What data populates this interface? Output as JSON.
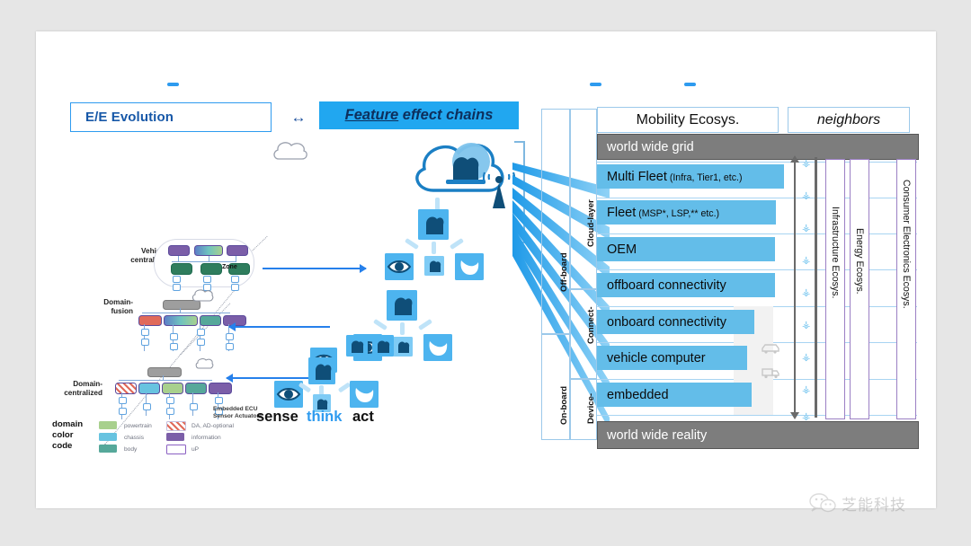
{
  "canvas": {
    "background": "#e6e6e6",
    "slide_background": "#ffffff"
  },
  "header": {
    "ee_evolution": "E/E Evolution",
    "bidirectional_arrow": "↔",
    "feature_effect_chains": {
      "underlined_word": "Feature",
      "rest": " effect chains",
      "full": "Feature effect chains"
    }
  },
  "left_diagram": {
    "levels": [
      {
        "label_line1": "Vehicle-",
        "label_line2": "centralized",
        "sublabel": "Zone"
      },
      {
        "label_line1": "Domain-",
        "label_line2": "fusion",
        "sublabel": ""
      },
      {
        "label_line1": "Domain-",
        "label_line2": "centralized",
        "sublabel": "Embedded ECU\nSensor Actuators"
      }
    ],
    "embedded_note_line1": "Embedded ECU",
    "embedded_note_line2": "Sensor Actuators",
    "zone_label": "Zone"
  },
  "legend": {
    "title_lines": [
      "domain",
      "color",
      "code"
    ],
    "items": [
      {
        "label": "powertrain",
        "color": "#a8d08d"
      },
      {
        "label": "chassis",
        "color": "#67c3e0"
      },
      {
        "label": "body",
        "color": "#56a89a"
      },
      {
        "label": "DA, AD-optional",
        "color": "#d9d2f0"
      },
      {
        "label": "information",
        "color": "#7b5ea8"
      },
      {
        "label": "uP",
        "color": "#ffffff"
      }
    ]
  },
  "sense_think_act": [
    {
      "label": "sense",
      "color": "#111111"
    },
    {
      "label": "think",
      "color": "#2e9bef"
    },
    {
      "label": "act",
      "color": "#111111"
    }
  ],
  "right_stack": {
    "headers": [
      {
        "label": "Mobility Ecosys.",
        "italic": false
      },
      {
        "label": "neighbors",
        "italic": true
      }
    ],
    "top_bar": "world wide grid",
    "bottom_bar": "world wide reality",
    "rows": [
      {
        "label": "Multi Fleet",
        "suffix": " (Infra, Tier1, etc.)"
      },
      {
        "label": "Fleet",
        "suffix": " (MSP*, LSP,** etc.)"
      },
      {
        "label": "OEM",
        "suffix": ""
      },
      {
        "label": "offboard connectivity",
        "suffix": ""
      },
      {
        "label": "onboard connectivity",
        "suffix": ""
      },
      {
        "label": "vehicle computer",
        "suffix": ""
      },
      {
        "label": "embedded",
        "suffix": ""
      }
    ],
    "outer_groups": [
      {
        "label": "Off-board"
      },
      {
        "label": "On-board"
      }
    ],
    "inner_groups": [
      {
        "label": "Cloud-layer"
      },
      {
        "label": "Connect-"
      },
      {
        "label": "Device-"
      }
    ],
    "ecosystems": [
      {
        "label": "Infrastructure Ecosys."
      },
      {
        "label": "Energy Ecosys."
      },
      {
        "label": "Consumer Electronics Ecosys."
      }
    ],
    "vehicle_icons": [
      {
        "name": "car-icon"
      },
      {
        "name": "truck-icon"
      }
    ],
    "accent_blue": "#63bde9",
    "grey_bar": "#7d7d7d",
    "eco_border": "#9b7fc4"
  },
  "watermark": {
    "text": "芝能科技",
    "icon": "wechat-icon"
  }
}
